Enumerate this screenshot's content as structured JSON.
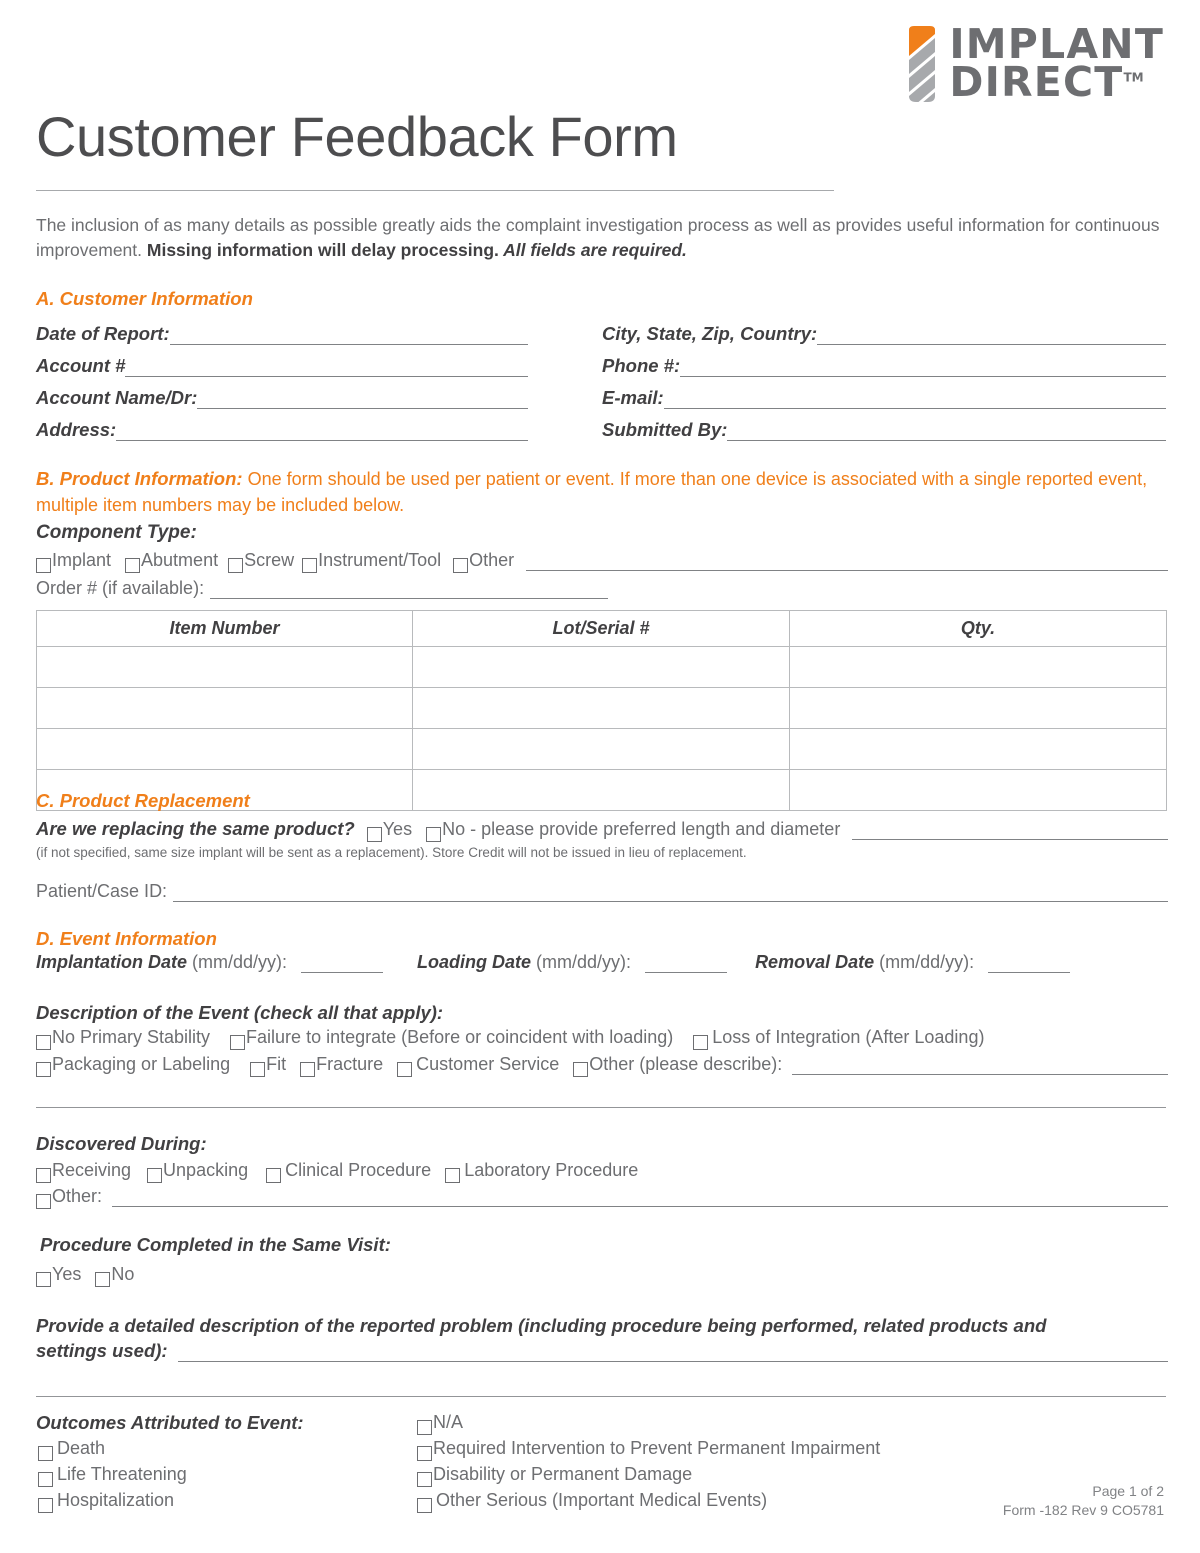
{
  "logo": {
    "line1": "IMPLANT",
    "line2": "DIRECT",
    "tm": "TM",
    "accent_color": "#f07f1a",
    "gray_color": "#a7a9ac"
  },
  "title": "Customer Feedback Form",
  "intro": {
    "part1": "The inclusion of as many details as possible greatly aids the complaint investigation process as well as provides useful information for continuous improvement. ",
    "bold": "Missing information will delay processing.",
    "italic_bold": " All fields are required."
  },
  "section_a": {
    "heading": "A. Customer Information",
    "left_fields": [
      {
        "label": "Date of Report:"
      },
      {
        "label": "Account #"
      },
      {
        "label": "Account Name/Dr:"
      },
      {
        "label": "Address:"
      }
    ],
    "right_fields": [
      {
        "label": "City, State, Zip, Country:"
      },
      {
        "label": "Phone #:"
      },
      {
        "label": "E-mail:"
      },
      {
        "label": "Submitted By:"
      }
    ]
  },
  "section_b": {
    "heading": "B. Product Information:",
    "body": " One form should be used per patient or event. If more than one device is associated with a single reported event, multiple item numbers may be included below.",
    "component_type_label": "Component Type:",
    "component_options": [
      "Implant",
      "Abutment",
      "Screw",
      "Instrument/Tool",
      "Other"
    ],
    "order_label": "Order # (if available):",
    "table": {
      "headers": [
        "Item Number",
        "Lot/Serial #",
        "Qty."
      ],
      "rows": [
        [
          "",
          "",
          ""
        ],
        [
          "",
          "",
          ""
        ],
        [
          "",
          "",
          ""
        ],
        [
          "",
          "",
          ""
        ]
      ]
    }
  },
  "section_c": {
    "heading": "C. Product Replacement",
    "question": "Are we replacing the same product?",
    "yes": "Yes",
    "no": "No - please provide preferred length and diameter",
    "note": "(if not specified, same size implant will be sent as a replacement). Store Credit will not be issued in lieu of replacement.",
    "patient_label": "Patient/Case ID:"
  },
  "section_d": {
    "heading": "D. Event Information",
    "dates": [
      {
        "label": "Implantation Date",
        "format": " (mm/dd/yy):"
      },
      {
        "label": "Loading Date",
        "format": " (mm/dd/yy):"
      },
      {
        "label": "Removal Date",
        "format": " (mm/dd/yy):"
      }
    ],
    "description_label": "Description of the Event (check all that apply):",
    "description_options_row1": [
      "No Primary Stability",
      "Failure to integrate (Before or coincident with loading)",
      "Loss of Integration (After Loading)"
    ],
    "description_options_row2": [
      "Packaging or Labeling",
      "Fit",
      "Fracture",
      "Customer Service",
      "Other (please describe):"
    ],
    "discovered_label": "Discovered During:",
    "discovered_options": [
      "Receiving",
      "Unpacking",
      "Clinical Procedure",
      "Laboratory Procedure"
    ],
    "discovered_other": "Other:",
    "procedure_label": "Procedure Completed in the Same Visit:",
    "procedure_options": [
      "Yes",
      "No"
    ],
    "detail_label_line1": "Provide a detailed description of the reported problem (including procedure being performed, related products and",
    "detail_label_line2": "settings used):",
    "outcomes_label": "Outcomes Attributed to Event:",
    "outcomes_left": [
      "Death",
      "Life Threatening",
      "Hospitalization"
    ],
    "outcomes_right": [
      "N/A",
      "Required Intervention to Prevent Permanent Impairment",
      "Disability or Permanent Damage",
      "Other Serious (Important Medical Events)"
    ]
  },
  "footer": {
    "page": "Page 1 of 2",
    "form_id": "Form -182 Rev 9 CO5781"
  }
}
